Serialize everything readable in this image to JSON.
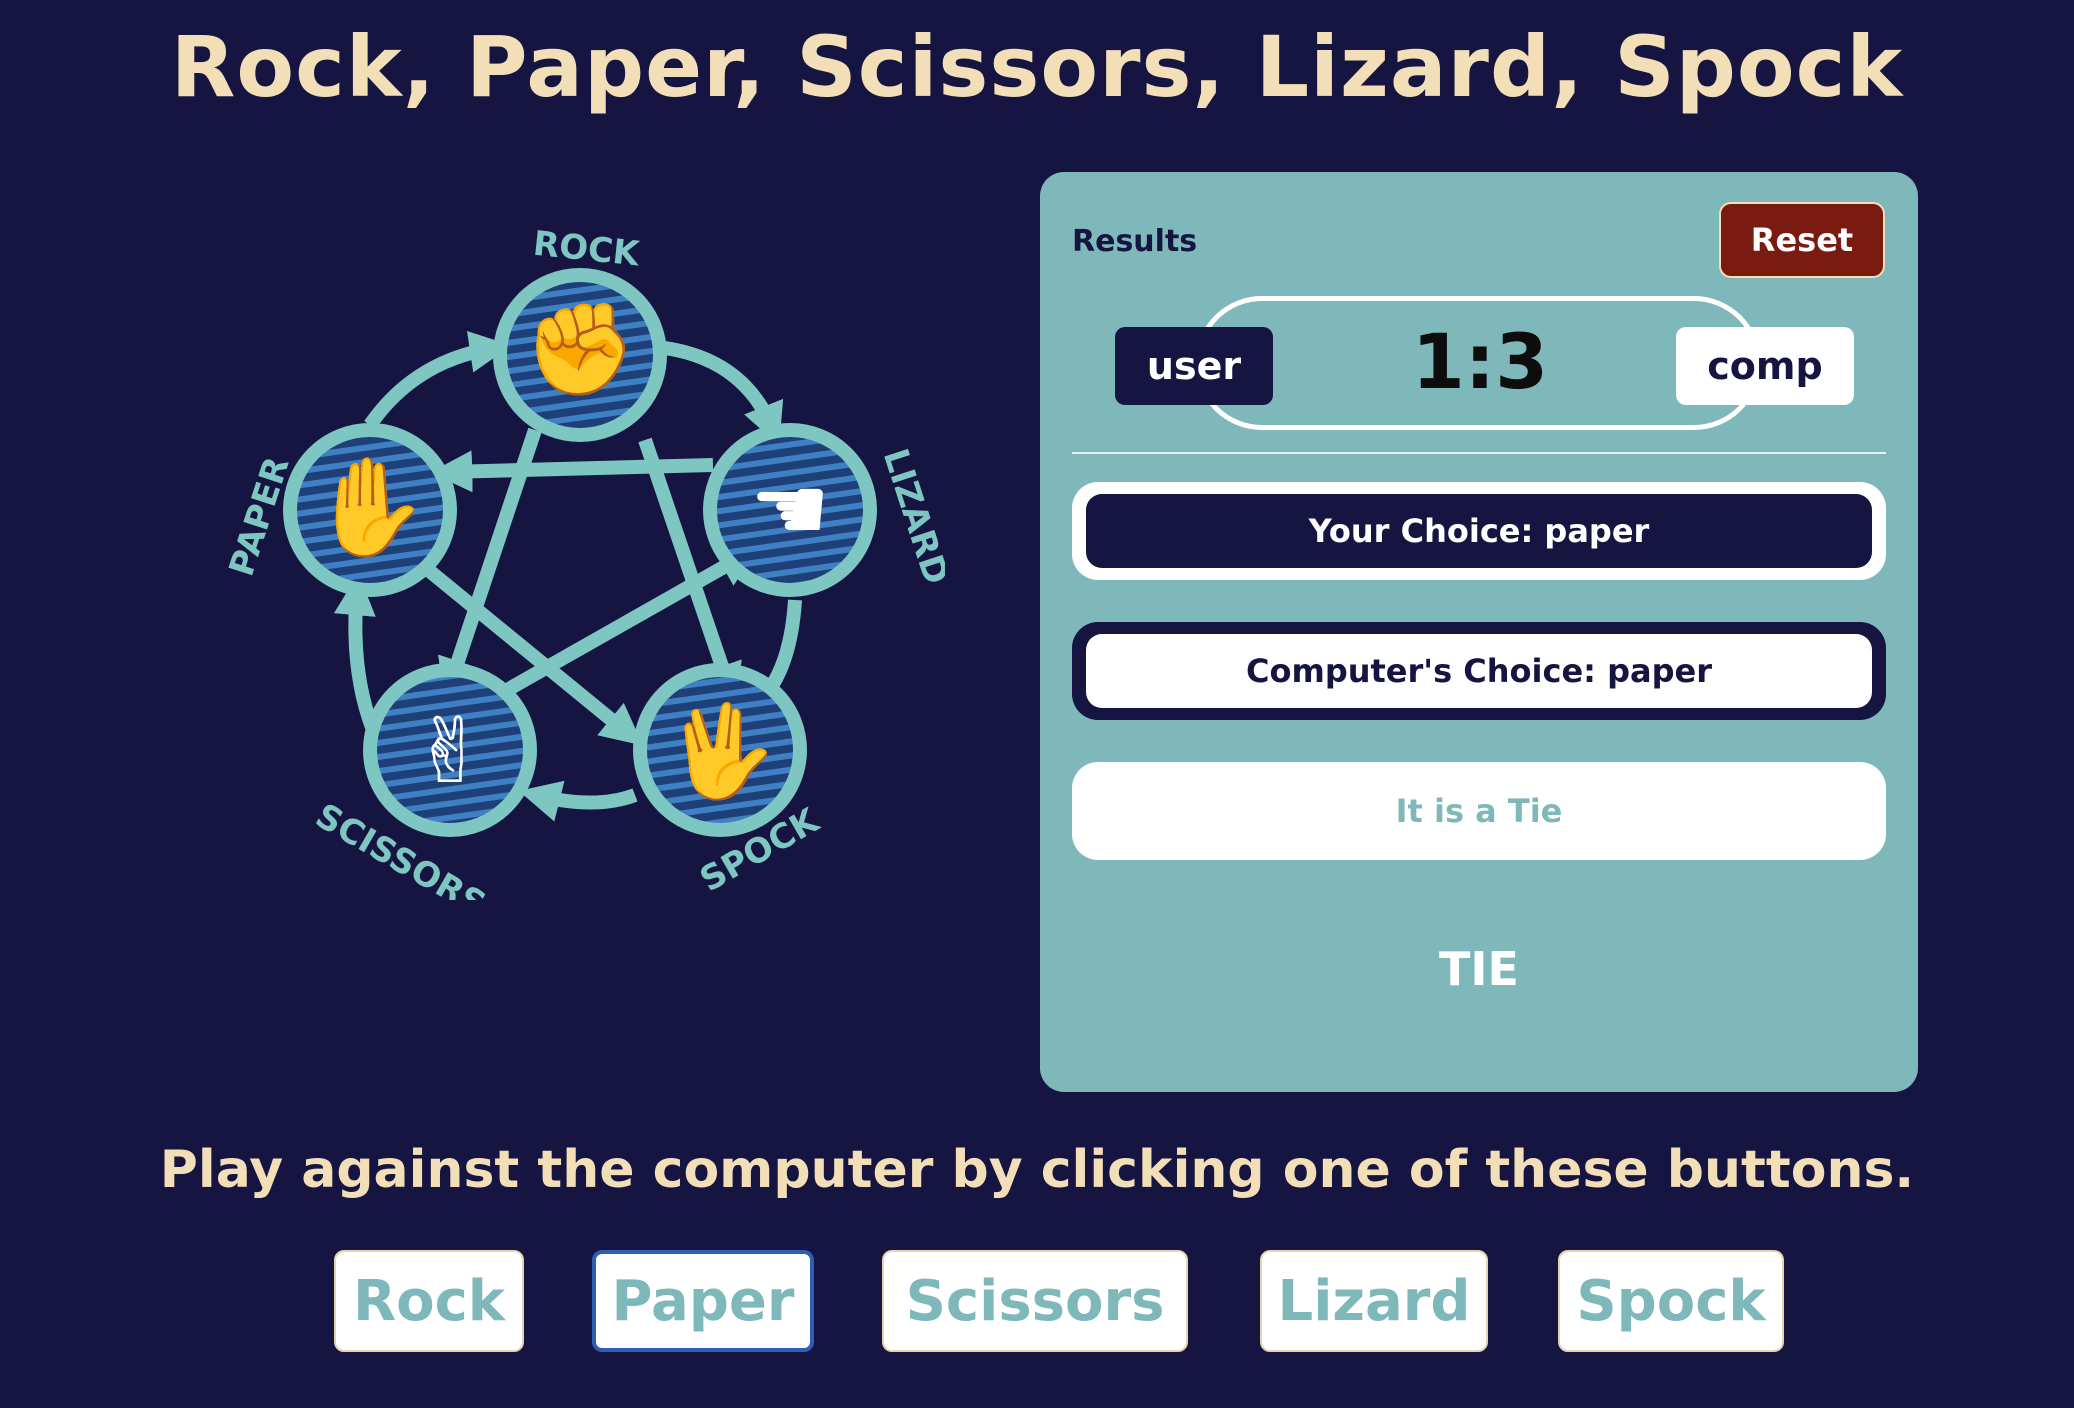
{
  "title": "Rock, Paper, Scissors, Lizard, Spock",
  "diagram": {
    "labels": {
      "rock": "ROCK",
      "paper": "PAPER",
      "scissors": "SCISSORS",
      "lizard": "LIZARD",
      "spock": "SPOCK"
    }
  },
  "results": {
    "label": "Results",
    "reset_label": "Reset",
    "user_label": "user",
    "comp_label": "comp",
    "score": "1:3",
    "your_choice": "Your Choice: paper",
    "computer_choice": "Computer's Choice: paper",
    "result_message": "It is a Tie",
    "outcome": "TIE"
  },
  "instructions": "Play against the computer by clicking one of these buttons.",
  "moves": [
    "Rock",
    "Paper",
    "Scissors",
    "Lizard",
    "Spock"
  ],
  "selected_move": "Paper",
  "colors": {
    "background": "#161440",
    "title": "#f2dfb8",
    "panel": "#7fb8ba",
    "reset": "#7a1b12",
    "diagram": "#7ec6c1",
    "node_fill": "#2b5a92"
  }
}
